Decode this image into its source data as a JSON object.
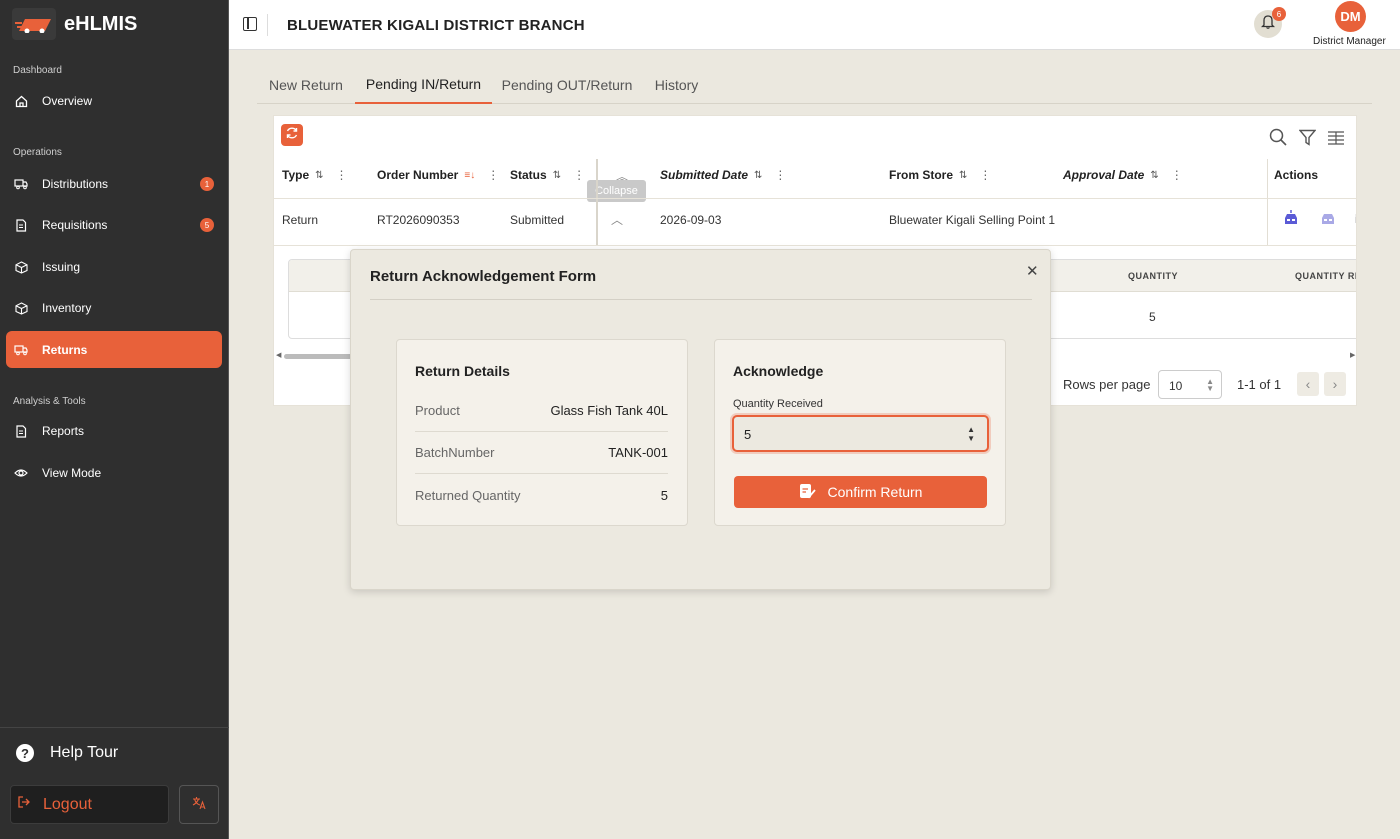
{
  "app": {
    "name": "eHLMIS",
    "branch_title": "BLUEWATER KIGALI DISTRICT BRANCH",
    "notification_count": "6",
    "user_initials": "DM",
    "user_role": "District Manager",
    "accent_color": "#e8613a"
  },
  "sidebar": {
    "sections": [
      {
        "label": "Dashboard"
      },
      {
        "label": "Operations"
      },
      {
        "label": "Analysis & Tools"
      }
    ],
    "items": [
      {
        "label": "Overview",
        "icon": "home-icon"
      },
      {
        "label": "Distributions",
        "icon": "truck-icon",
        "badge": "1"
      },
      {
        "label": "Requisitions",
        "icon": "document-icon",
        "badge": "5"
      },
      {
        "label": "Issuing",
        "icon": "box-icon"
      },
      {
        "label": "Inventory",
        "icon": "box-icon"
      },
      {
        "label": "Returns",
        "icon": "truck-icon",
        "active": true
      },
      {
        "label": "Reports",
        "icon": "document-icon"
      },
      {
        "label": "View Mode",
        "icon": "eye-icon"
      }
    ],
    "help_tour": "Help Tour",
    "logout": "Logout"
  },
  "tabs": [
    {
      "label": "New Return"
    },
    {
      "label": "Pending IN/Return",
      "active": true
    },
    {
      "label": "Pending OUT/Return"
    },
    {
      "label": "History"
    }
  ],
  "table": {
    "columns": [
      {
        "label": "Type"
      },
      {
        "label": "Order Number"
      },
      {
        "label": "Status"
      },
      {
        "label": "Submitted Date"
      },
      {
        "label": "From Store"
      },
      {
        "label": "Approval Date"
      },
      {
        "label": "Actions"
      }
    ],
    "rows": [
      {
        "type": "Return",
        "order_number": "RT2026090353",
        "status": "Submitted",
        "submitted_date": "2026-09-03",
        "from_store": "Bluewater Kigali Selling Point 1",
        "approval_date": ""
      }
    ],
    "collapse_tooltip": "Collapse",
    "sub_columns": [
      {
        "label": "QUANTITY"
      },
      {
        "label": "QUANTITY RE"
      }
    ],
    "sub_row": {
      "quantity": "5"
    },
    "pagination": {
      "rows_per_page_label": "Rows per page",
      "rows_per_page": "10",
      "range": "1-1 of 1"
    }
  },
  "modal": {
    "title": "Return Acknowledgement Form",
    "details_title": "Return Details",
    "details": [
      {
        "label": "Product",
        "value": "Glass Fish Tank 40L"
      },
      {
        "label": "BatchNumber",
        "value": "TANK-001"
      },
      {
        "label": "Returned Quantity",
        "value": "5"
      }
    ],
    "ack_title": "Acknowledge",
    "quantity_label": "Quantity Received",
    "quantity_value": "5",
    "confirm_label": "Confirm Return"
  }
}
